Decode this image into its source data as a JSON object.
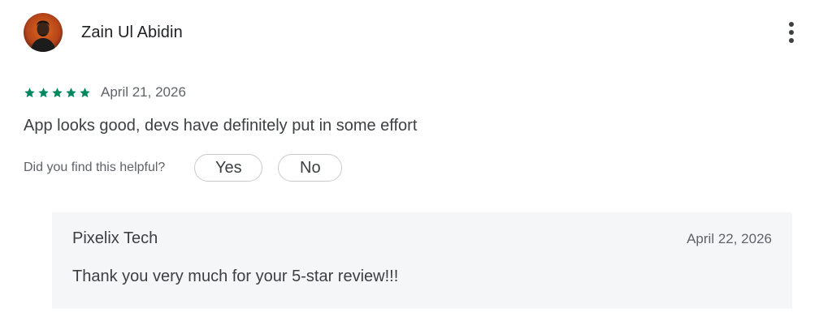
{
  "review": {
    "reviewer_name": "Zain Ul Abidin",
    "avatar_icon": "person-photo-icon",
    "rating": 5,
    "max_rating": 5,
    "star_color": "#01875f",
    "date": "April 21, 2026",
    "text": "App looks good, devs have definitely put in some effort",
    "more_options_icon": "more-vert-icon"
  },
  "helpful": {
    "label": "Did you find this helpful?",
    "yes_label": "Yes",
    "no_label": "No"
  },
  "developer_reply": {
    "name": "Pixelix Tech",
    "date": "April 22, 2026",
    "text": "Thank you very much for your 5-star review!!!"
  }
}
